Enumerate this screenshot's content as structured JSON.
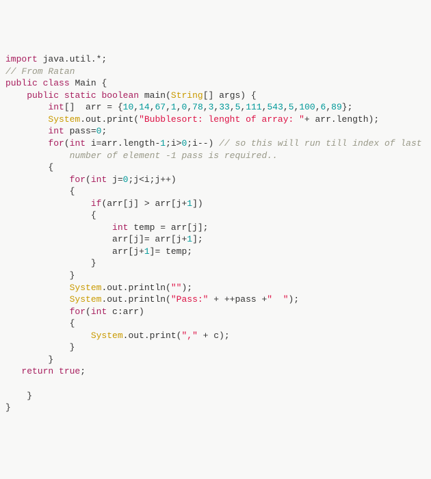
{
  "line1_kw": "import",
  "line1_rest": " java.util.*;",
  "line2_cmt": "// From Ratan",
  "line3_a": "public",
  "line3_b": " ",
  "line3_c": "class",
  "line3_d": " Main {",
  "line4_a": "    ",
  "line4_b": "public",
  "line4_c": " ",
  "line4_d": "static",
  "line4_e": " ",
  "line4_f": "boolean",
  "line4_g": " main(",
  "line4_h": "String",
  "line4_i": "[] args) {",
  "line5_a": "        ",
  "line5_b": "int",
  "line5_c": "[]  arr = {",
  "line5_d": "10",
  "line5_e": ",",
  "line5_f": "14",
  "line5_g": ",",
  "line5_h": "67",
  "line5_i": ",",
  "line5_j": "1",
  "line5_k": ",",
  "line5_l": "0",
  "line5_m": ",",
  "line5_n": "78",
  "line5_o": ",",
  "line5_p": "3",
  "line5_q": ",",
  "line5_r": "33",
  "line5_s": ",",
  "line5_t": "5",
  "line5_u": ",",
  "line5_v": "111",
  "line5_w": ",",
  "line5_x": "543",
  "line5_y": ",",
  "line5_z": "5",
  "line5_aa": ",",
  "line5_bb": "100",
  "line5_cc": ",",
  "line5_dd": "6",
  "line5_ee": ",",
  "line5_ff": "89",
  "line5_gg": "};",
  "line6_a": "        ",
  "line6_b": "System",
  "line6_c": ".out.print(",
  "line6_d": "\"Bubblesort: lenght of array: \"",
  "line6_e": "+ arr.length);",
  "line7_a": "        ",
  "line7_b": "int",
  "line7_c": " pass=",
  "line7_d": "0",
  "line7_e": ";",
  "line8_a": "        ",
  "line8_b": "for",
  "line8_c": "(",
  "line8_d": "int",
  "line8_e": " i=arr.length-",
  "line8_f": "1",
  "line8_g": ";i>",
  "line8_h": "0",
  "line8_i": ";i--) ",
  "line8_j": "// so this will run till index of last ",
  "line8b_indent": "            ",
  "line8b_cmt": "number of element -1 pass is required..",
  "line9": "        {",
  "line10_a": "            ",
  "line10_b": "for",
  "line10_c": "(",
  "line10_d": "int",
  "line10_e": " j=",
  "line10_f": "0",
  "line10_g": ";j<i;j++)",
  "line11": "            {",
  "line12_a": "                ",
  "line12_b": "if",
  "line12_c": "(arr[j] > arr[j+",
  "line12_d": "1",
  "line12_e": "])",
  "line13": "                {",
  "line14_a": "                    ",
  "line14_b": "int",
  "line14_c": " temp = arr[j];",
  "line15": "                    arr[j]= arr[j+",
  "line15_b": "1",
  "line15_c": "];",
  "line16": "                    arr[j+",
  "line16_b": "1",
  "line16_c": "]= temp;",
  "line17": "                }",
  "line18": "            }",
  "line19_a": "            ",
  "line19_b": "System",
  "line19_c": ".out.println(",
  "line19_d": "\"\"",
  "line19_e": ");",
  "line20_a": "            ",
  "line20_b": "System",
  "line20_c": ".out.println(",
  "line20_d": "\"Pass:\"",
  "line20_e": " + ++pass +",
  "line20_f": "\"  \"",
  "line20_g": ");",
  "line21_a": "            ",
  "line21_b": "for",
  "line21_c": "(",
  "line21_d": "int",
  "line21_e": " c:arr)",
  "line22": "            {",
  "line23_a": "                ",
  "line23_b": "System",
  "line23_c": ".out.print(",
  "line23_d": "\",\"",
  "line23_e": " + c);",
  "line24": "            }",
  "line25": "        }",
  "line26_a": "   ",
  "line26_b": "return",
  "line26_c": " ",
  "line26_d": "true",
  "line26_e": ";",
  "line27": "",
  "line28": "    }",
  "line29": "}"
}
